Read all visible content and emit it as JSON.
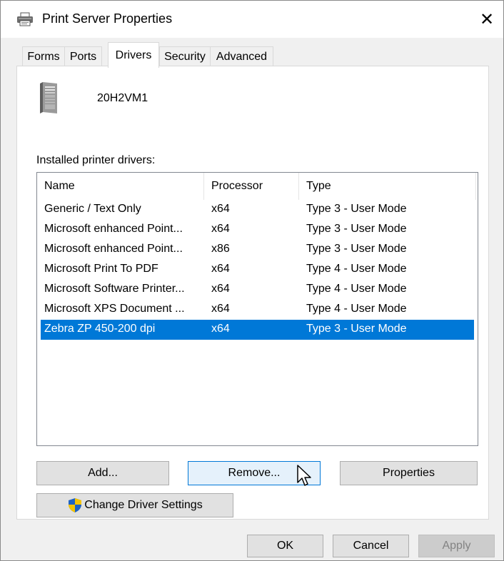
{
  "window": {
    "title": "Print Server Properties",
    "close_glyph": "✕",
    "title_icon": "printer-icon"
  },
  "tabs": [
    {
      "label": "Forms",
      "active": false
    },
    {
      "label": "Ports",
      "active": false
    },
    {
      "label": "Drivers",
      "active": true
    },
    {
      "label": "Security",
      "active": false
    },
    {
      "label": "Advanced",
      "active": false
    }
  ],
  "server": {
    "icon": "computer-tower-icon",
    "name": "20H2VM1"
  },
  "drivers_label": "Installed printer drivers:",
  "table": {
    "columns": [
      "Name",
      "Processor",
      "Type"
    ],
    "rows": [
      {
        "name": "Generic / Text Only",
        "processor": "x64",
        "type": "Type 3 - User Mode",
        "selected": false
      },
      {
        "name": "Microsoft enhanced Point...",
        "processor": "x64",
        "type": "Type 3 - User Mode",
        "selected": false
      },
      {
        "name": "Microsoft enhanced Point...",
        "processor": "x86",
        "type": "Type 3 - User Mode",
        "selected": false
      },
      {
        "name": "Microsoft Print To PDF",
        "processor": "x64",
        "type": "Type 4 - User Mode",
        "selected": false
      },
      {
        "name": "Microsoft Software Printer...",
        "processor": "x64",
        "type": "Type 4 - User Mode",
        "selected": false
      },
      {
        "name": "Microsoft XPS Document ...",
        "processor": "x64",
        "type": "Type 4 - User Mode",
        "selected": false
      },
      {
        "name": "Zebra  ZP 450-200 dpi",
        "processor": "x64",
        "type": "Type 3 - User Mode",
        "selected": true
      }
    ]
  },
  "buttons": {
    "add": "Add...",
    "remove": "Remove...",
    "properties": "Properties",
    "change_driver_settings": "Change Driver Settings",
    "ok": "OK",
    "cancel": "Cancel",
    "apply": "Apply"
  },
  "colors": {
    "selection": "#0078d7",
    "dialog_bg": "#f0f0f0",
    "shield_blue": "#1e63c4",
    "shield_yellow": "#f5c400"
  }
}
